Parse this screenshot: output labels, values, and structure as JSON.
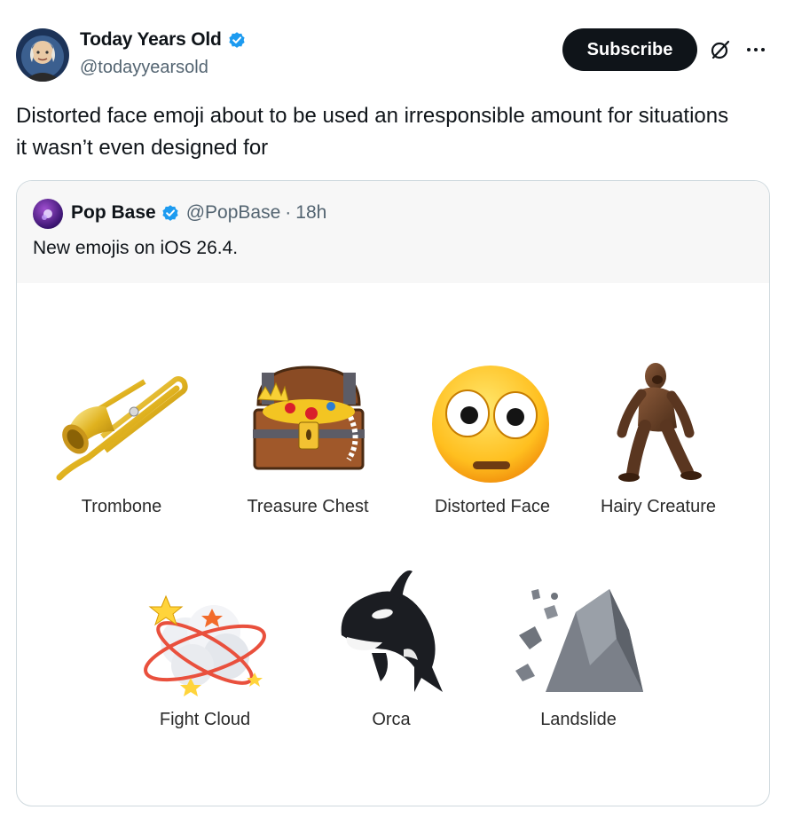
{
  "author": {
    "display_name": "Today Years Old",
    "handle": "@todayyearsold"
  },
  "actions": {
    "subscribe_label": "Subscribe",
    "grok_icon": "grok-icon",
    "more_icon": "more-icon"
  },
  "tweet": {
    "text": "Distorted face emoji about to be used an irresponsible amount for situations it wasn’t even designed for"
  },
  "quote": {
    "display_name": "Pop Base",
    "handle": "@PopBase",
    "separator": "·",
    "time": "18h",
    "text": "New emojis on iOS 26.4.",
    "emojis": [
      {
        "label": "Trombone",
        "icon": "trombone-icon"
      },
      {
        "label": "Treasure Chest",
        "icon": "treasure-chest-icon"
      },
      {
        "label": "Distorted Face",
        "icon": "distorted-face-icon"
      },
      {
        "label": "Hairy Creature",
        "icon": "hairy-creature-icon"
      },
      {
        "label": "Fight Cloud",
        "icon": "fight-cloud-icon"
      },
      {
        "label": "Orca",
        "icon": "orca-icon"
      },
      {
        "label": "Landslide",
        "icon": "landslide-icon"
      }
    ]
  },
  "colors": {
    "verified_blue": "#1d9bf0",
    "text_primary": "#0f1419",
    "text_secondary": "#536471",
    "subscribe_bg": "#0f1419"
  }
}
